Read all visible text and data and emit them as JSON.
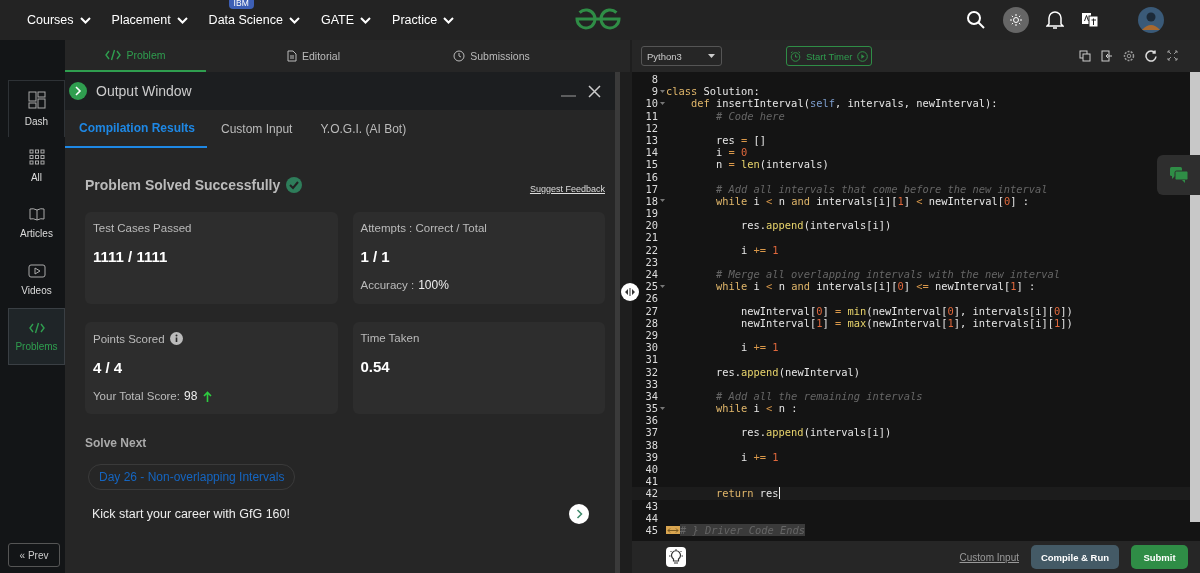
{
  "nav": {
    "items": [
      {
        "label": "Courses"
      },
      {
        "label": "Placement"
      },
      {
        "label": "Data Science",
        "badge": "IBM"
      },
      {
        "label": "GATE"
      },
      {
        "label": "Practice"
      }
    ]
  },
  "problem_tabs": [
    {
      "label": "Problem",
      "selected": true
    },
    {
      "label": "Editorial",
      "selected": false
    },
    {
      "label": "Submissions",
      "selected": false
    }
  ],
  "sidebar": {
    "items": [
      {
        "label": "Dash",
        "selected": false
      },
      {
        "label": "All",
        "selected": false
      },
      {
        "label": "Articles",
        "selected": false
      },
      {
        "label": "Videos",
        "selected": false
      },
      {
        "label": "Problems",
        "selected": true
      }
    ],
    "prev_button": "« Prev"
  },
  "output_window": {
    "title": "Output Window",
    "tabs": [
      {
        "label": "Compilation Results",
        "selected": true
      },
      {
        "label": "Custom Input",
        "selected": false
      },
      {
        "label": "Y.O.G.I. (AI Bot)",
        "selected": false
      }
    ],
    "status": "Problem Solved Successfully",
    "feedback_link": "Suggest Feedback",
    "cards": [
      {
        "label": "Test Cases Passed",
        "info": false,
        "value": "1111 / 1111",
        "trend_up": false
      },
      {
        "label": "Attempts : Correct / Total",
        "info": false,
        "value": "1 / 1",
        "note_label": "Accuracy :",
        "note_value": "100%",
        "trend_up": false
      },
      {
        "label": "Points Scored",
        "info": true,
        "value": "4 / 4",
        "note_label": "Your Total Score:",
        "note_value": "98",
        "trend_up": true
      },
      {
        "label": "Time Taken",
        "info": false,
        "value": "0.54",
        "trend_up": false
      }
    ],
    "solve_next": {
      "heading": "Solve Next",
      "link": "Day 26 - Non-overlapping Intervals"
    },
    "promo": "Kick start your career with GfG 160!"
  },
  "editor": {
    "language": "Python3",
    "timer_button": "Start Timer",
    "lines": [
      {
        "number": "8",
        "fold": false,
        "active": false,
        "folded": false
      },
      {
        "number": "9",
        "fold": true,
        "active": false,
        "folded": false,
        "tokens": [
          {
            "kind": "kw",
            "text": "class"
          },
          {
            "kind": "plain",
            "text": " Solution:"
          }
        ]
      },
      {
        "number": "10",
        "fold": true,
        "active": false,
        "folded": false,
        "tokens": [
          {
            "kind": "kw",
            "text": "    def"
          },
          {
            "kind": "plain",
            "text": " insertInterval("
          },
          {
            "kind": "self",
            "text": "self"
          },
          {
            "kind": "plain",
            "text": ", intervals, newInterval):"
          }
        ]
      },
      {
        "number": "11",
        "fold": false,
        "active": false,
        "folded": false,
        "tokens": [
          {
            "kind": "cm",
            "text": "        # Code here"
          }
        ]
      },
      {
        "number": "12",
        "fold": false,
        "active": false,
        "folded": false
      },
      {
        "number": "13",
        "fold": false,
        "active": false,
        "folded": false,
        "tokens": [
          {
            "kind": "plain",
            "text": "        res "
          },
          {
            "kind": "op",
            "text": "="
          },
          {
            "kind": "plain",
            "text": " []"
          }
        ]
      },
      {
        "number": "14",
        "fold": false,
        "active": false,
        "folded": false,
        "tokens": [
          {
            "kind": "plain",
            "text": "        i "
          },
          {
            "kind": "op",
            "text": "="
          },
          {
            "kind": "num",
            "text": " 0"
          }
        ]
      },
      {
        "number": "15",
        "fold": false,
        "active": false,
        "folded": false,
        "tokens": [
          {
            "kind": "plain",
            "text": "        n "
          },
          {
            "kind": "op",
            "text": "="
          },
          {
            "kind": "fn",
            "text": " len"
          },
          {
            "kind": "plain",
            "text": "(intervals)"
          }
        ]
      },
      {
        "number": "16",
        "fold": false,
        "active": false,
        "folded": false
      },
      {
        "number": "17",
        "fold": false,
        "active": false,
        "folded": false,
        "tokens": [
          {
            "kind": "cm",
            "text": "        # Add all intervals that come before the new interval"
          }
        ]
      },
      {
        "number": "18",
        "fold": true,
        "active": false,
        "folded": false,
        "tokens": [
          {
            "kind": "kw",
            "text": "        while"
          },
          {
            "kind": "plain",
            "text": " i "
          },
          {
            "kind": "op",
            "text": "<"
          },
          {
            "kind": "plain",
            "text": " n "
          },
          {
            "kind": "kw",
            "text": "and"
          },
          {
            "kind": "plain",
            "text": " intervals[i]["
          },
          {
            "kind": "num",
            "text": "1"
          },
          {
            "kind": "plain",
            "text": "] "
          },
          {
            "kind": "op",
            "text": "<"
          },
          {
            "kind": "plain",
            "text": " newInterval["
          },
          {
            "kind": "num",
            "text": "0"
          },
          {
            "kind": "plain",
            "text": "] :"
          }
        ]
      },
      {
        "number": "19",
        "fold": false,
        "active": false,
        "folded": false
      },
      {
        "number": "20",
        "fold": false,
        "active": false,
        "folded": false,
        "tokens": [
          {
            "kind": "plain",
            "text": "            res."
          },
          {
            "kind": "fn",
            "text": "append"
          },
          {
            "kind": "plain",
            "text": "(intervals[i])"
          }
        ]
      },
      {
        "number": "21",
        "fold": false,
        "active": false,
        "folded": false
      },
      {
        "number": "22",
        "fold": false,
        "active": false,
        "folded": false,
        "tokens": [
          {
            "kind": "plain",
            "text": "            i "
          },
          {
            "kind": "op",
            "text": "+="
          },
          {
            "kind": "num",
            "text": " 1"
          }
        ]
      },
      {
        "number": "23",
        "fold": false,
        "active": false,
        "folded": false
      },
      {
        "number": "24",
        "fold": false,
        "active": false,
        "folded": false,
        "tokens": [
          {
            "kind": "cm",
            "text": "        # Merge all overlapping intervals with the new interval"
          }
        ]
      },
      {
        "number": "25",
        "fold": true,
        "active": false,
        "folded": false,
        "tokens": [
          {
            "kind": "kw",
            "text": "        while"
          },
          {
            "kind": "plain",
            "text": " i "
          },
          {
            "kind": "op",
            "text": "<"
          },
          {
            "kind": "plain",
            "text": " n "
          },
          {
            "kind": "kw",
            "text": "and"
          },
          {
            "kind": "plain",
            "text": " intervals[i]["
          },
          {
            "kind": "num",
            "text": "0"
          },
          {
            "kind": "plain",
            "text": "] "
          },
          {
            "kind": "op",
            "text": "<="
          },
          {
            "kind": "plain",
            "text": " newInterval["
          },
          {
            "kind": "num",
            "text": "1"
          },
          {
            "kind": "plain",
            "text": "] :"
          }
        ]
      },
      {
        "number": "26",
        "fold": false,
        "active": false,
        "folded": false
      },
      {
        "number": "27",
        "fold": false,
        "active": false,
        "folded": false,
        "tokens": [
          {
            "kind": "plain",
            "text": "            newInterval["
          },
          {
            "kind": "num",
            "text": "0"
          },
          {
            "kind": "plain",
            "text": "] "
          },
          {
            "kind": "op",
            "text": "="
          },
          {
            "kind": "fn",
            "text": " min"
          },
          {
            "kind": "plain",
            "text": "(newInterval["
          },
          {
            "kind": "num",
            "text": "0"
          },
          {
            "kind": "plain",
            "text": "], intervals[i]["
          },
          {
            "kind": "num",
            "text": "0"
          },
          {
            "kind": "plain",
            "text": "])"
          }
        ]
      },
      {
        "number": "28",
        "fold": false,
        "active": false,
        "folded": false,
        "tokens": [
          {
            "kind": "plain",
            "text": "            newInterval["
          },
          {
            "kind": "num",
            "text": "1"
          },
          {
            "kind": "plain",
            "text": "] "
          },
          {
            "kind": "op",
            "text": "="
          },
          {
            "kind": "fn",
            "text": " max"
          },
          {
            "kind": "plain",
            "text": "(newInterval["
          },
          {
            "kind": "num",
            "text": "1"
          },
          {
            "kind": "plain",
            "text": "], intervals[i]["
          },
          {
            "kind": "num",
            "text": "1"
          },
          {
            "kind": "plain",
            "text": "])"
          }
        ]
      },
      {
        "number": "29",
        "fold": false,
        "active": false,
        "folded": false
      },
      {
        "number": "30",
        "fold": false,
        "active": false,
        "folded": false,
        "tokens": [
          {
            "kind": "plain",
            "text": "            i "
          },
          {
            "kind": "op",
            "text": "+="
          },
          {
            "kind": "num",
            "text": " 1"
          }
        ]
      },
      {
        "number": "31",
        "fold": false,
        "active": false,
        "folded": false
      },
      {
        "number": "32",
        "fold": false,
        "active": false,
        "folded": false,
        "tokens": [
          {
            "kind": "plain",
            "text": "        res."
          },
          {
            "kind": "fn",
            "text": "append"
          },
          {
            "kind": "plain",
            "text": "(newInterval)"
          }
        ]
      },
      {
        "number": "33",
        "fold": false,
        "active": false,
        "folded": false
      },
      {
        "number": "34",
        "fold": false,
        "active": false,
        "folded": false,
        "tokens": [
          {
            "kind": "cm",
            "text": "        # Add all the remaining intervals"
          }
        ]
      },
      {
        "number": "35",
        "fold": true,
        "active": false,
        "folded": false,
        "tokens": [
          {
            "kind": "kw",
            "text": "        while"
          },
          {
            "kind": "plain",
            "text": " i "
          },
          {
            "kind": "op",
            "text": "<"
          },
          {
            "kind": "plain",
            "text": " n :"
          }
        ]
      },
      {
        "number": "36",
        "fold": false,
        "active": false,
        "folded": false
      },
      {
        "number": "37",
        "fold": false,
        "active": false,
        "folded": false,
        "tokens": [
          {
            "kind": "plain",
            "text": "            res."
          },
          {
            "kind": "fn",
            "text": "append"
          },
          {
            "kind": "plain",
            "text": "(intervals[i])"
          }
        ]
      },
      {
        "number": "38",
        "fold": false,
        "active": false,
        "folded": false
      },
      {
        "number": "39",
        "fold": false,
        "active": false,
        "folded": false,
        "tokens": [
          {
            "kind": "plain",
            "text": "            i "
          },
          {
            "kind": "op",
            "text": "+="
          },
          {
            "kind": "num",
            "text": " 1"
          }
        ]
      },
      {
        "number": "40",
        "fold": false,
        "active": false,
        "folded": false
      },
      {
        "number": "41",
        "fold": false,
        "active": false,
        "folded": false
      },
      {
        "number": "42",
        "fold": false,
        "active": true,
        "folded": false,
        "tokens": [
          {
            "kind": "kw",
            "text": "        return"
          },
          {
            "kind": "plain",
            "text": " res"
          }
        ]
      },
      {
        "number": "43",
        "fold": false,
        "active": false,
        "folded": false
      },
      {
        "number": "44",
        "fold": false,
        "active": false,
        "folded": false
      },
      {
        "number": "45",
        "fold": false,
        "active": false,
        "folded": true,
        "tokens": [
          {
            "kind": "cm",
            "text": "# } Driver Code Ends"
          }
        ]
      }
    ],
    "footer": {
      "custom_input_link": "Custom Input",
      "run_button": "Compile & Run",
      "submit_button": "Submit"
    }
  }
}
